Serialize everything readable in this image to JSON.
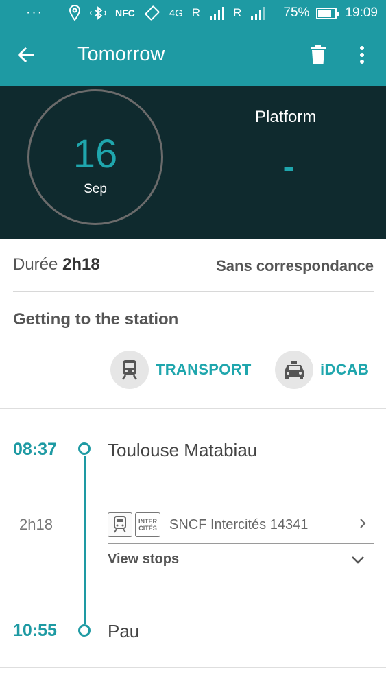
{
  "status_bar": {
    "dots": "···",
    "nfc": "NFC",
    "net1": "4G",
    "roaming1": "R",
    "roaming2": "R",
    "battery_percent": "75%",
    "time": "19:09"
  },
  "app_bar": {
    "title": "Tomorrow"
  },
  "header": {
    "day": "16",
    "month": "Sep",
    "platform_label": "Platform",
    "platform_value": "-"
  },
  "summary": {
    "duration_label": "Durée",
    "duration_value": "2h18",
    "connections": "Sans correspondance"
  },
  "getting_to_station": {
    "title": "Getting to the station",
    "options": [
      {
        "label": "TRANSPORT",
        "icon": "train-icon"
      },
      {
        "label": "iDCAB",
        "icon": "taxi-icon"
      }
    ]
  },
  "journey": {
    "departure": {
      "time": "08:37",
      "station": "Toulouse Matabiau"
    },
    "duration": "2h18",
    "train": {
      "badge_top": "INTER",
      "badge_bottom": "CITÉS",
      "name": "SNCF Intercités 14341"
    },
    "view_stops": "View stops",
    "arrival": {
      "time": "10:55",
      "station": "Pau"
    }
  },
  "colors": {
    "accent": "#1e9aa3",
    "header_bg": "#0f2a2e"
  }
}
